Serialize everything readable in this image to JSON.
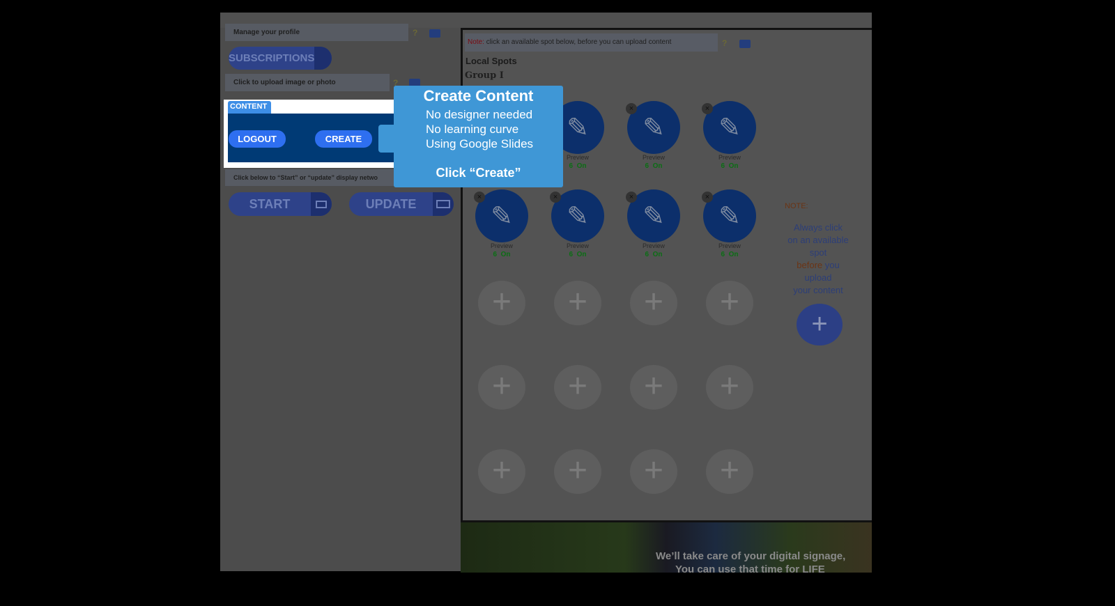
{
  "left": {
    "profile_label": "Manage your profile",
    "subscriptions": "SUBSCRIPTIONS",
    "upload_label": "Click to upload image or photo",
    "content_tab": "CONTENT",
    "logout": "LOGOUT",
    "create": "CREATE",
    "network_label": "Click below to “Start” or “update” display  netwo",
    "start": "START",
    "update": "UPDATE"
  },
  "right": {
    "note_prefix": "Note:",
    "note_text": "click an available spot below, before you can upload content",
    "title": "Local Spots",
    "group": "Group I",
    "spots": [
      {
        "preview": "Preview",
        "count": "6",
        "status": "On"
      },
      {
        "preview": "Preview",
        "count": "6",
        "status": "On"
      },
      {
        "preview": "Preview",
        "count": "6",
        "status": "On"
      },
      {
        "preview": "Preview",
        "count": "6",
        "status": "On"
      },
      {
        "preview": "Preview",
        "count": "6",
        "status": "On"
      },
      {
        "preview": "Preview",
        "count": "6",
        "status": "On"
      },
      {
        "preview": "Preview",
        "count": "6",
        "status": "On"
      }
    ],
    "side_note_title": "NOTE:",
    "side_note_1": "Always click",
    "side_note_2": "on an available",
    "side_note_3": "spot",
    "side_note_before": "before",
    "side_note_you": " you",
    "side_note_4": "upload",
    "side_note_5": "your content",
    "banner_1": "We’ll take care of your digital signage,",
    "banner_2": "You can use that time for LIFE"
  },
  "tooltip": {
    "title": "Create Content",
    "line1": "No designer needed",
    "line2": "No learning curve",
    "line3": "Using Google Slides",
    "cta": "Click “Create”"
  },
  "colors": {
    "accent": "#3f97d6",
    "brand_dark": "#003a75",
    "button": "#2e6ff0"
  }
}
